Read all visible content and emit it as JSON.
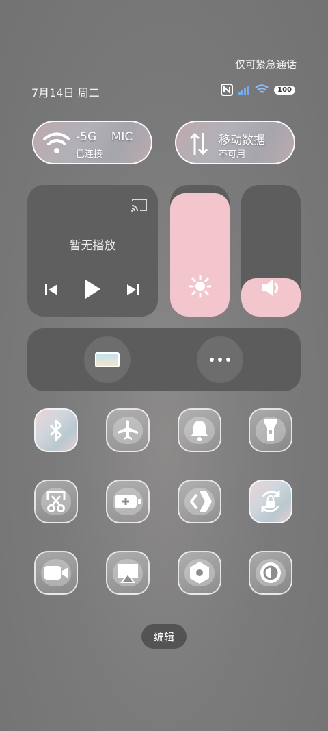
{
  "status_bar": {
    "emergency_text": "仅可紧急通话",
    "date_text": "7月14日 周二",
    "battery_level": "100",
    "icons": [
      "nfc-icon",
      "signal-icon",
      "wifi-icon",
      "battery-icon"
    ]
  },
  "connectivity": {
    "wifi": {
      "name": "-5G    MIC",
      "status": "已连接"
    },
    "mobile_data": {
      "title": "移动数据",
      "status": "不可用"
    }
  },
  "media": {
    "now_playing": "暂无播放",
    "icons": [
      "cast-icon",
      "previous-icon",
      "play-icon",
      "next-icon"
    ]
  },
  "sliders": {
    "brightness": {
      "level": 0.94,
      "color": "#f2c6cc"
    },
    "volume": {
      "level": 0.29,
      "color": "#f2c6cc"
    }
  },
  "shortcuts": {
    "icons": [
      "screen-card-icon",
      "more-icon"
    ]
  },
  "toggles": [
    {
      "name": "bluetooth",
      "icon": "bluetooth-icon",
      "active": true
    },
    {
      "name": "airplane-mode",
      "icon": "airplane-icon",
      "active": false
    },
    {
      "name": "ring-mode",
      "icon": "bell-icon",
      "active": false
    },
    {
      "name": "flashlight",
      "icon": "flashlight-icon",
      "active": false
    },
    {
      "name": "screenshot",
      "icon": "scissors-icon",
      "active": false
    },
    {
      "name": "battery-saver",
      "icon": "battery-plus-icon",
      "active": false
    },
    {
      "name": "share",
      "icon": "share-arrows-icon",
      "active": false
    },
    {
      "name": "rotation-lock",
      "icon": "rotation-lock-icon",
      "active": true
    },
    {
      "name": "screen-record",
      "icon": "video-camera-icon",
      "active": false
    },
    {
      "name": "screen-cast",
      "icon": "airplay-icon",
      "active": false
    },
    {
      "name": "settings",
      "icon": "hexagon-gear-icon",
      "active": false
    },
    {
      "name": "dark-mode",
      "icon": "contrast-icon",
      "active": false
    }
  ],
  "edit_button": {
    "label": "编辑"
  }
}
